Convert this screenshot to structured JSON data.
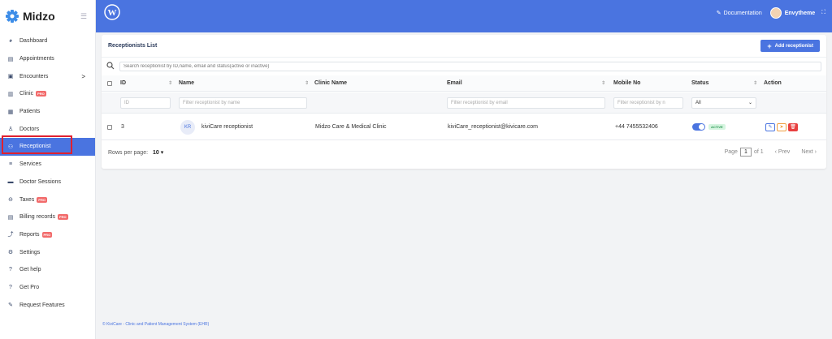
{
  "app": {
    "brand": "Midzo"
  },
  "sidebar": {
    "items": [
      {
        "label": "Dashboard",
        "icon": "dashboard-icon"
      },
      {
        "label": "Appointments",
        "icon": "calendar-icon"
      },
      {
        "label": "Encounters",
        "icon": "encounter-icon",
        "chevron": ">"
      },
      {
        "label": "Clinic",
        "icon": "clinic-icon",
        "pro": "PRO"
      },
      {
        "label": "Patients",
        "icon": "patients-icon"
      },
      {
        "label": "Doctors",
        "icon": "doctor-icon"
      },
      {
        "label": "Receptionist",
        "icon": "receptionist-icon",
        "active": true
      },
      {
        "label": "Services",
        "icon": "services-icon"
      },
      {
        "label": "Doctor Sessions",
        "icon": "sessions-icon"
      },
      {
        "label": "Taxes",
        "icon": "taxes-icon",
        "pro": "PRO"
      },
      {
        "label": "Billing records",
        "icon": "billing-icon",
        "pro": "PRO"
      },
      {
        "label": "Reports",
        "icon": "reports-icon",
        "pro": "PRO"
      },
      {
        "label": "Settings",
        "icon": "settings-icon"
      },
      {
        "label": "Get help",
        "icon": "help-icon"
      },
      {
        "label": "Get Pro",
        "icon": "help-icon"
      },
      {
        "label": "Request Features",
        "icon": "edit-icon"
      }
    ]
  },
  "header": {
    "documentation": "Documentation",
    "username": "Envytheme"
  },
  "card": {
    "title": "Receptionists List",
    "add_button": "Add receptionist",
    "search_placeholder": "Search receptionist by ID,name, email and status(active or inactive)"
  },
  "table": {
    "columns": [
      "ID",
      "Name",
      "Clinic Name",
      "Email",
      "Mobile No",
      "Status",
      "Action"
    ],
    "filters": {
      "id": "ID",
      "name": "Filter receptionist by name",
      "email": "Filter receptionist by email",
      "mobile": "Filter receptionist by n",
      "status": "All"
    },
    "rows": [
      {
        "id": "3",
        "initials": "KR",
        "name": "kiviCare receptionist",
        "clinic": "Midzo Care & Medical Clinic",
        "email": "kiviCare_receptionist@kivicare.com",
        "mobile": "+44 7455532406",
        "status": "ACTIVE"
      }
    ]
  },
  "pagination": {
    "rows_per_page_label": "Rows per page:",
    "rows_per_page": "10",
    "page_label": "Page",
    "page": "1",
    "of": "of 1",
    "prev": "Prev",
    "next": "Next"
  },
  "footer": {
    "copyright": "© KiviCare - Clinic and Patient Management System (EHR)"
  },
  "colors": {
    "primary": "#4a74e0",
    "danger": "#e84040",
    "success": "#2f9a57",
    "highlight": "#e0202e"
  }
}
